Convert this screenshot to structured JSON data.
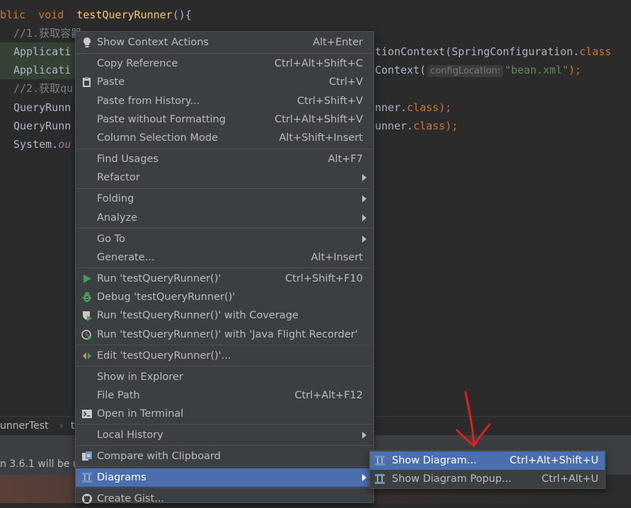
{
  "editor": {
    "line1": {
      "kw1": "blic",
      "kw2": "void",
      "fn": "testQueryRunner",
      "tail": "(){"
    },
    "line2": {
      "comment": "//1.获取容器"
    },
    "line3": {
      "left": "Applicati",
      "right_a": "tionContext(SpringConfiguration.",
      "right_b": "class"
    },
    "line4": {
      "left": "Applicati",
      "right_a": "Context(",
      "hint": "configLocation:",
      "str": "\"bean.xml\"",
      "tail": ");"
    },
    "line5": {
      "comment": "//2.获取qu"
    },
    "line6": {
      "left": "QueryRunn",
      "right_a": "nner.",
      "kw": "class",
      "tail": ");"
    },
    "line7": {
      "left": "QueryRunn",
      "right_a": "unner.",
      "kw": "class",
      "tail": ");"
    },
    "line8": {
      "left": "System.",
      "field": "ou"
    }
  },
  "breadcrumb": {
    "item1": "unnerTest",
    "sep": "›",
    "item2": "t"
  },
  "status": {
    "text": "n 3.6.1 will be u"
  },
  "colors": {
    "selection": "#4b6eaf",
    "menu_bg": "#3c3f41",
    "run_green": "#499c54",
    "annotation_red": "#e0201b"
  },
  "context_menu": {
    "show_context_actions": {
      "label": "Show Context Actions",
      "shortcut": "Alt+Enter",
      "icon": "lightbulb-icon"
    },
    "copy_reference": {
      "label": "Copy Reference",
      "shortcut": "Ctrl+Alt+Shift+C"
    },
    "paste": {
      "label": "Paste",
      "shortcut": "Ctrl+V",
      "icon": "clipboard-icon"
    },
    "paste_from_history": {
      "label": "Paste from History...",
      "shortcut": "Ctrl+Shift+V"
    },
    "paste_without_formatting": {
      "label": "Paste without Formatting",
      "shortcut": "Ctrl+Alt+Shift+V"
    },
    "column_selection_mode": {
      "label": "Column Selection Mode",
      "shortcut": "Alt+Shift+Insert"
    },
    "find_usages": {
      "label": "Find Usages",
      "shortcut": "Alt+F7"
    },
    "refactor": {
      "label": "Refactor"
    },
    "folding": {
      "label": "Folding"
    },
    "analyze": {
      "label": "Analyze"
    },
    "go_to": {
      "label": "Go To"
    },
    "generate": {
      "label": "Generate...",
      "shortcut": "Alt+Insert"
    },
    "run": {
      "label": "Run 'testQueryRunner()'",
      "shortcut": "Ctrl+Shift+F10",
      "icon": "run-icon"
    },
    "debug": {
      "label": "Debug 'testQueryRunner()'",
      "icon": "debug-icon"
    },
    "run_coverage": {
      "label": "Run 'testQueryRunner()' with Coverage",
      "icon": "coverage-icon"
    },
    "run_jfr": {
      "label": "Run 'testQueryRunner()' with 'Java Flight Recorder'",
      "icon": "profiler-icon"
    },
    "edit_config": {
      "label": "Edit 'testQueryRunner()'...",
      "icon": "edit-config-icon"
    },
    "show_in_explorer": {
      "label": "Show in Explorer"
    },
    "file_path": {
      "label": "File Path",
      "shortcut": "Ctrl+Alt+F12"
    },
    "open_in_terminal": {
      "label": "Open in Terminal",
      "icon": "terminal-icon"
    },
    "local_history": {
      "label": "Local History"
    },
    "compare_clipboard": {
      "label": "Compare with Clipboard",
      "icon": "compare-icon"
    },
    "diagrams": {
      "label": "Diagrams",
      "icon": "diagram-icon"
    },
    "create_gist": {
      "label": "Create Gist...",
      "icon": "github-icon"
    }
  },
  "diagrams_submenu": {
    "show_diagram": {
      "label": "Show Diagram...",
      "shortcut": "Ctrl+Alt+Shift+U",
      "icon": "diagram-icon"
    },
    "show_diagram_popup": {
      "label": "Show Diagram Popup...",
      "shortcut": "Ctrl+Alt+U",
      "icon": "diagram-icon"
    }
  }
}
